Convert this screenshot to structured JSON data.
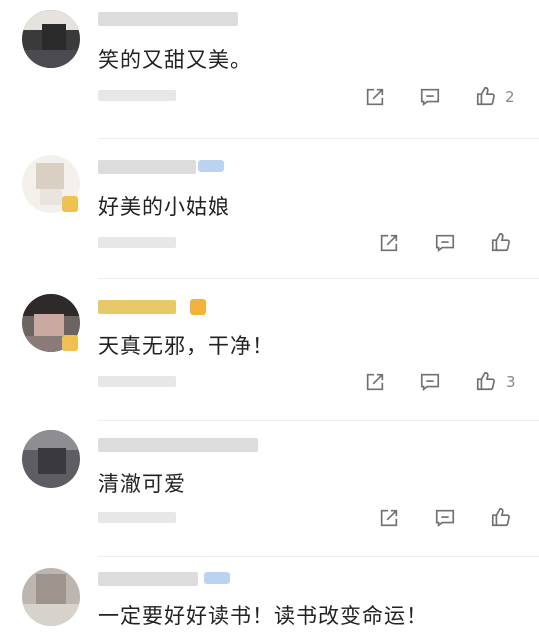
{
  "comments": [
    {
      "text": "笑的又甜又美。",
      "likes": "2"
    },
    {
      "text": "好美的小姑娘",
      "likes": ""
    },
    {
      "text": "天真无邪，干净！",
      "likes": "3"
    },
    {
      "text": "清澈可爱",
      "likes": ""
    },
    {
      "text": "一定要好好读书！读书改变命运！",
      "likes": ""
    }
  ],
  "icons": {
    "share": "share-icon",
    "reply": "comment-icon",
    "like": "thumbs-up-icon"
  }
}
